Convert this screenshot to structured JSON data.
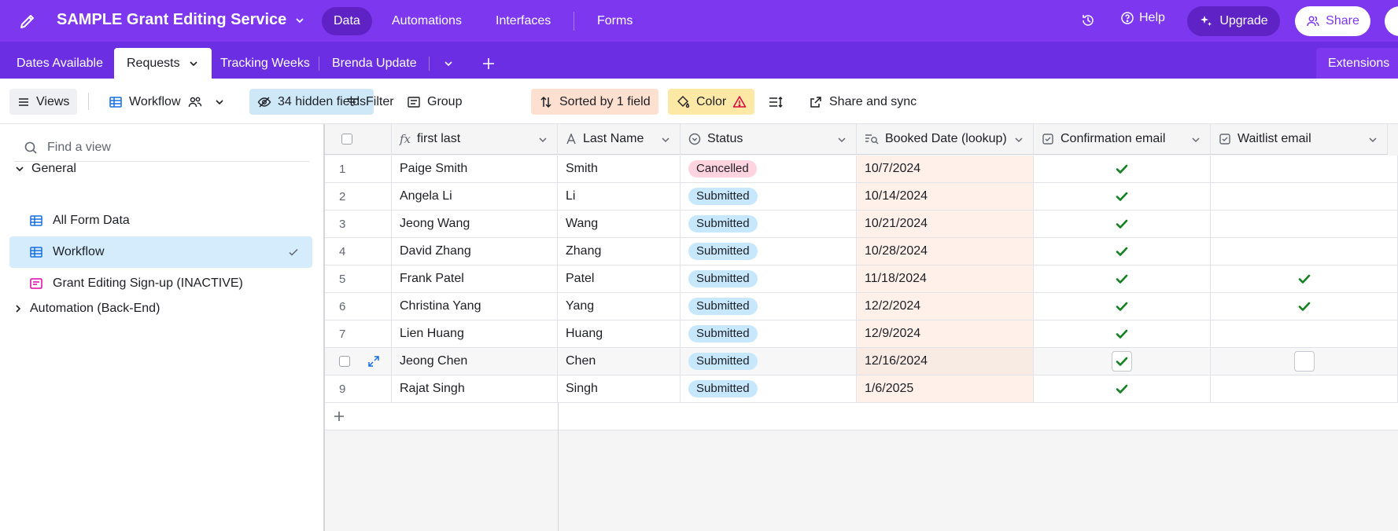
{
  "app": {
    "base_title": "SAMPLE Grant Editing Service",
    "nav": [
      "Data",
      "Automations",
      "Interfaces",
      "Forms"
    ],
    "help": "Help",
    "upgrade": "Upgrade",
    "share": "Share",
    "accent": "#7c37ef"
  },
  "tabs": {
    "items": [
      "Dates Available",
      "Requests",
      "Tracking Weeks",
      "Brenda Update"
    ],
    "extensions": "Extensions"
  },
  "toolbar": {
    "views": "Views",
    "current_view": "Workflow",
    "hidden_fields": "34 hidden fields",
    "filter": "Filter",
    "group": "Group",
    "sorted": "Sorted by 1 field",
    "color": "Color",
    "share_sync": "Share and sync"
  },
  "sidebar": {
    "search_placeholder": "Find a view",
    "sections": [
      "General",
      "Automation (Back-End)"
    ],
    "views": [
      {
        "label": "All Form Data",
        "icon": "grid-icon"
      },
      {
        "label": "Workflow",
        "icon": "grid-icon",
        "active": true
      },
      {
        "label": "Grant Editing Sign-up (INACTIVE)",
        "icon": "form-icon"
      }
    ]
  },
  "grid": {
    "columns": [
      "first last",
      "Last Name",
      "Status",
      "Booked Date (lookup)",
      "Confirmation email",
      "Waitlist email"
    ],
    "rows": [
      {
        "n": "1",
        "first_last": "Paige Smith",
        "last": "Smith",
        "status": "Cancelled",
        "date": "10/7/2024",
        "confirm": true,
        "waitlist": false
      },
      {
        "n": "2",
        "first_last": "Angela Li",
        "last": "Li",
        "status": "Submitted",
        "date": "10/14/2024",
        "confirm": true,
        "waitlist": false
      },
      {
        "n": "3",
        "first_last": "Jeong Wang",
        "last": "Wang",
        "status": "Submitted",
        "date": "10/21/2024",
        "confirm": true,
        "waitlist": false
      },
      {
        "n": "4",
        "first_last": "David Zhang",
        "last": "Zhang",
        "status": "Submitted",
        "date": "10/28/2024",
        "confirm": true,
        "waitlist": false
      },
      {
        "n": "5",
        "first_last": "Frank Patel",
        "last": "Patel",
        "status": "Submitted",
        "date": "11/18/2024",
        "confirm": true,
        "waitlist": true
      },
      {
        "n": "6",
        "first_last": "Christina Yang",
        "last": "Yang",
        "status": "Submitted",
        "date": "12/2/2024",
        "confirm": true,
        "waitlist": true
      },
      {
        "n": "7",
        "first_last": "Lien Huang",
        "last": "Huang",
        "status": "Submitted",
        "date": "12/9/2024",
        "confirm": true,
        "waitlist": false
      },
      {
        "n": "",
        "first_last": "Jeong Chen",
        "last": "Chen",
        "status": "Submitted",
        "date": "12/16/2024",
        "confirm": true,
        "waitlist": false,
        "hover": true
      },
      {
        "n": "9",
        "first_last": "Rajat Singh",
        "last": "Singh",
        "status": "Submitted",
        "date": "1/6/2025",
        "confirm": true,
        "waitlist": false
      }
    ],
    "status_colors": {
      "Cancelled": "#ffd4e0",
      "Submitted": "#c7e8fc"
    },
    "check_color": "#11821f"
  }
}
